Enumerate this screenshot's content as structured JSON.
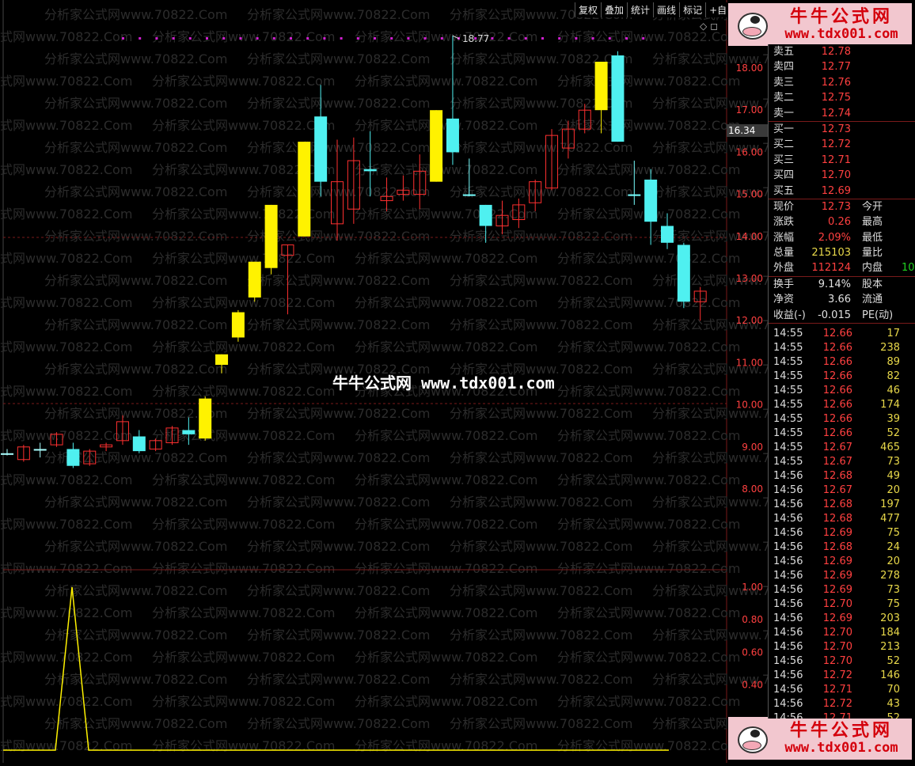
{
  "toolbar": [
    "复权",
    "叠加",
    "统计",
    "画线",
    "标记",
    "+自"
  ],
  "watermark_text": "分析家公式网www.70822.Com",
  "center_watermark": "牛牛公式网 www.tdx001.com",
  "brand": {
    "title": "牛牛公式网",
    "url": "www.tdx001.com"
  },
  "top_icons": {
    "diamond": "◇",
    "square": "◻"
  },
  "main_chart": {
    "price_labels": [
      "18.00",
      "17.00",
      "16.00",
      "15.00",
      "14.00",
      "13.00",
      "12.00",
      "11.00",
      "10.00",
      "9.00",
      "8.00"
    ],
    "price_values": [
      18,
      17,
      16,
      15,
      14,
      13,
      12,
      11,
      10,
      9,
      8
    ],
    "current_price_tag": "16.34",
    "high_label": "18.77",
    "candles": [
      {
        "o": 8.85,
        "h": 8.95,
        "l": 8.8,
        "c": 8.85,
        "color": "cross"
      },
      {
        "o": 8.7,
        "h": 9.05,
        "l": 8.65,
        "c": 9.0,
        "color": "red"
      },
      {
        "o": 8.95,
        "h": 9.1,
        "l": 8.75,
        "c": 8.95,
        "color": "cross"
      },
      {
        "o": 9.05,
        "h": 9.35,
        "l": 9.0,
        "c": 9.3,
        "color": "red"
      },
      {
        "o": 8.95,
        "h": 9.1,
        "l": 8.5,
        "c": 8.55,
        "color": "cyan"
      },
      {
        "o": 8.6,
        "h": 8.95,
        "l": 8.55,
        "c": 8.9,
        "color": "red"
      },
      {
        "o": 9.0,
        "h": 9.1,
        "l": 8.9,
        "c": 9.05,
        "color": "red"
      },
      {
        "o": 9.15,
        "h": 9.75,
        "l": 9.05,
        "c": 9.6,
        "color": "red"
      },
      {
        "o": 9.25,
        "h": 9.4,
        "l": 8.85,
        "c": 8.9,
        "color": "cyan"
      },
      {
        "o": 8.95,
        "h": 9.2,
        "l": 8.9,
        "c": 9.15,
        "color": "red"
      },
      {
        "o": 9.1,
        "h": 9.5,
        "l": 9.05,
        "c": 9.45,
        "color": "red"
      },
      {
        "o": 9.3,
        "h": 9.7,
        "l": 9.05,
        "c": 9.4,
        "color": "cyan"
      },
      {
        "o": 9.2,
        "h": 10.2,
        "l": 9.15,
        "c": 10.15,
        "color": "yellow"
      },
      {
        "o": 10.95,
        "h": 11.15,
        "l": 10.75,
        "c": 11.2,
        "color": "yellow"
      },
      {
        "o": 11.6,
        "h": 12.25,
        "l": 11.5,
        "c": 12.2,
        "color": "yellow"
      },
      {
        "o": 12.55,
        "h": 13.4,
        "l": 12.45,
        "c": 13.4,
        "color": "yellow"
      },
      {
        "o": 13.25,
        "h": 14.75,
        "l": 13.1,
        "c": 14.75,
        "color": "yellow"
      },
      {
        "o": 13.55,
        "h": 13.55,
        "l": 12.15,
        "c": 13.8,
        "color": "red"
      },
      {
        "o": 14.0,
        "h": 16.25,
        "l": 14.0,
        "c": 16.25,
        "color": "yellow"
      },
      {
        "o": 16.85,
        "h": 17.6,
        "l": 14.95,
        "c": 15.3,
        "color": "cyan"
      },
      {
        "o": 14.3,
        "h": 16.3,
        "l": 13.9,
        "c": 15.3,
        "color": "red"
      },
      {
        "o": 14.65,
        "h": 16.35,
        "l": 14.3,
        "c": 15.8,
        "color": "red"
      },
      {
        "o": 15.55,
        "h": 16.5,
        "l": 14.95,
        "c": 15.6,
        "color": "cyan"
      },
      {
        "o": 14.85,
        "h": 15.4,
        "l": 14.6,
        "c": 14.95,
        "color": "red"
      },
      {
        "o": 15.0,
        "h": 15.45,
        "l": 14.85,
        "c": 15.1,
        "color": "red"
      },
      {
        "o": 15.0,
        "h": 15.95,
        "l": 14.65,
        "c": 15.55,
        "color": "red"
      },
      {
        "o": 15.3,
        "h": 17.0,
        "l": 15.3,
        "c": 17.0,
        "color": "yellow"
      },
      {
        "o": 16.8,
        "h": 18.77,
        "l": 15.7,
        "c": 16.0,
        "color": "cyan"
      },
      {
        "o": 15.0,
        "h": 15.85,
        "l": 14.95,
        "c": 15.0,
        "color": "cross"
      },
      {
        "o": 14.75,
        "h": 14.75,
        "l": 13.85,
        "c": 14.25,
        "color": "cyan"
      },
      {
        "o": 14.25,
        "h": 14.85,
        "l": 14.05,
        "c": 14.5,
        "color": "red"
      },
      {
        "o": 14.4,
        "h": 14.9,
        "l": 14.2,
        "c": 14.75,
        "color": "red"
      },
      {
        "o": 14.8,
        "h": 15.35,
        "l": 14.6,
        "c": 15.3,
        "color": "red"
      },
      {
        "o": 15.15,
        "h": 16.55,
        "l": 15.1,
        "c": 16.4,
        "color": "red"
      },
      {
        "o": 16.1,
        "h": 16.75,
        "l": 15.85,
        "c": 16.55,
        "color": "red"
      },
      {
        "o": 16.55,
        "h": 17.15,
        "l": 16.45,
        "c": 17.0,
        "color": "red"
      },
      {
        "o": 17.0,
        "h": 17.0,
        "l": 16.45,
        "c": 18.15,
        "color": "yellow"
      },
      {
        "o": 18.3,
        "h": 18.4,
        "l": 16.5,
        "c": 16.25,
        "color": "cyan"
      },
      {
        "o": 15.0,
        "h": 15.8,
        "l": 14.75,
        "c": 15.0,
        "color": "cross"
      },
      {
        "o": 15.35,
        "h": 15.6,
        "l": 13.8,
        "c": 14.35,
        "color": "cyan"
      },
      {
        "o": 14.25,
        "h": 14.55,
        "l": 13.7,
        "c": 13.85,
        "color": "cyan"
      },
      {
        "o": 13.8,
        "h": 13.85,
        "l": 12.3,
        "c": 12.45,
        "color": "cyan"
      },
      {
        "o": 12.45,
        "h": 12.8,
        "l": 12.0,
        "c": 12.7,
        "color": "red"
      }
    ]
  },
  "sub_chart": {
    "labels": [
      "1.00",
      "0.80",
      "0.60",
      "0.40"
    ],
    "values": [
      1.0,
      0.8,
      0.6,
      0.4
    ]
  },
  "order_book": {
    "asks": [
      {
        "label": "卖五",
        "price": "12.78"
      },
      {
        "label": "卖四",
        "price": "12.77"
      },
      {
        "label": "卖三",
        "price": "12.76"
      },
      {
        "label": "卖二",
        "price": "12.75"
      },
      {
        "label": "卖一",
        "price": "12.74"
      }
    ],
    "bids": [
      {
        "label": "买一",
        "price": "12.73"
      },
      {
        "label": "买二",
        "price": "12.72"
      },
      {
        "label": "买三",
        "price": "12.71"
      },
      {
        "label": "买四",
        "price": "12.70"
      },
      {
        "label": "买五",
        "price": "12.69"
      }
    ]
  },
  "quote": [
    {
      "l1": "现价",
      "v1": "12.73",
      "c1": "#ff4040",
      "l2": "今开"
    },
    {
      "l1": "涨跌",
      "v1": "0.26",
      "c1": "#ff4040",
      "l2": "最高"
    },
    {
      "l1": "涨幅",
      "v1": "2.09%",
      "c1": "#ff4040",
      "l2": "最低"
    },
    {
      "l1": "总量",
      "v1": "215103",
      "c1": "#e8d84a",
      "l2": "量比"
    },
    {
      "l1": "外盘",
      "v1": "112124",
      "c1": "#ff4040",
      "l2": "内盘",
      "v2": "10",
      "c2": "#20d020"
    }
  ],
  "fundamentals": [
    {
      "l1": "换手",
      "v1": "9.14%",
      "l2": "股本"
    },
    {
      "l1": "净资",
      "v1": "3.66",
      "l2": "流通"
    },
    {
      "l1": "收益(-)",
      "v1": "-0.015",
      "l2": "PE(动)"
    }
  ],
  "ticks": [
    {
      "time": "14:55",
      "price": "12.66",
      "vol": "17"
    },
    {
      "time": "14:55",
      "price": "12.66",
      "vol": "238"
    },
    {
      "time": "14:55",
      "price": "12.66",
      "vol": "89"
    },
    {
      "time": "14:55",
      "price": "12.66",
      "vol": "82"
    },
    {
      "time": "14:55",
      "price": "12.66",
      "vol": "46"
    },
    {
      "time": "14:55",
      "price": "12.66",
      "vol": "174"
    },
    {
      "time": "14:55",
      "price": "12.66",
      "vol": "39"
    },
    {
      "time": "14:55",
      "price": "12.66",
      "vol": "52"
    },
    {
      "time": "14:55",
      "price": "12.67",
      "vol": "465"
    },
    {
      "time": "14:55",
      "price": "12.67",
      "vol": "73"
    },
    {
      "time": "14:56",
      "price": "12.68",
      "vol": "49"
    },
    {
      "time": "14:56",
      "price": "12.67",
      "vol": "20"
    },
    {
      "time": "14:56",
      "price": "12.68",
      "vol": "197"
    },
    {
      "time": "14:56",
      "price": "12.68",
      "vol": "477"
    },
    {
      "time": "14:56",
      "price": "12.69",
      "vol": "75"
    },
    {
      "time": "14:56",
      "price": "12.68",
      "vol": "24"
    },
    {
      "time": "14:56",
      "price": "12.69",
      "vol": "20"
    },
    {
      "time": "14:56",
      "price": "12.69",
      "vol": "278"
    },
    {
      "time": "14:56",
      "price": "12.69",
      "vol": "73"
    },
    {
      "time": "14:56",
      "price": "12.70",
      "vol": "75"
    },
    {
      "time": "14:56",
      "price": "12.69",
      "vol": "203"
    },
    {
      "time": "14:56",
      "price": "12.70",
      "vol": "184"
    },
    {
      "time": "14:56",
      "price": "12.70",
      "vol": "213"
    },
    {
      "time": "14:56",
      "price": "12.70",
      "vol": "52"
    },
    {
      "time": "14:56",
      "price": "12.72",
      "vol": "146"
    },
    {
      "time": "14:56",
      "price": "12.71",
      "vol": "70"
    },
    {
      "time": "14:56",
      "price": "12.72",
      "vol": "43"
    },
    {
      "time": "14:56",
      "price": "12.71",
      "vol": "52"
    }
  ],
  "colors": {
    "up": "#ff3030",
    "down": "#4ff0f0",
    "yellow": "#fff200",
    "grid": "#7a1a1a",
    "axis": "#ff4040",
    "magenta": "#d020d0"
  }
}
